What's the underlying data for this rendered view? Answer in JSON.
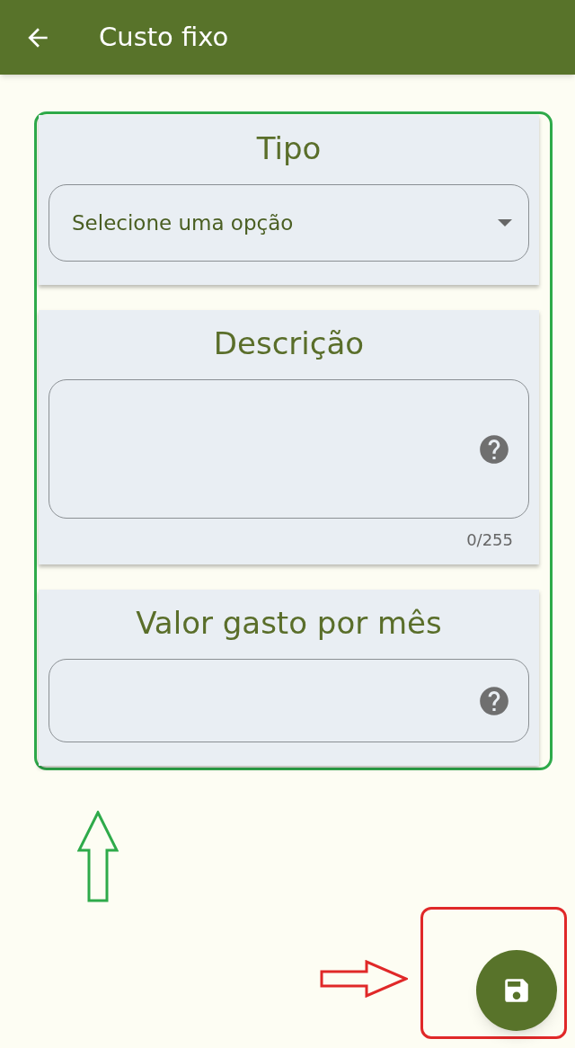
{
  "header": {
    "title": "Custo fixo"
  },
  "cards": [
    {
      "title": "Tipo",
      "field": {
        "kind": "select",
        "placeholder": "Selecione uma opção"
      }
    },
    {
      "title": "Descrição",
      "field": {
        "kind": "textarea",
        "help": true,
        "counter": "0/255"
      }
    },
    {
      "title": "Valor gasto por mês",
      "field": {
        "kind": "input",
        "help": true
      }
    }
  ]
}
